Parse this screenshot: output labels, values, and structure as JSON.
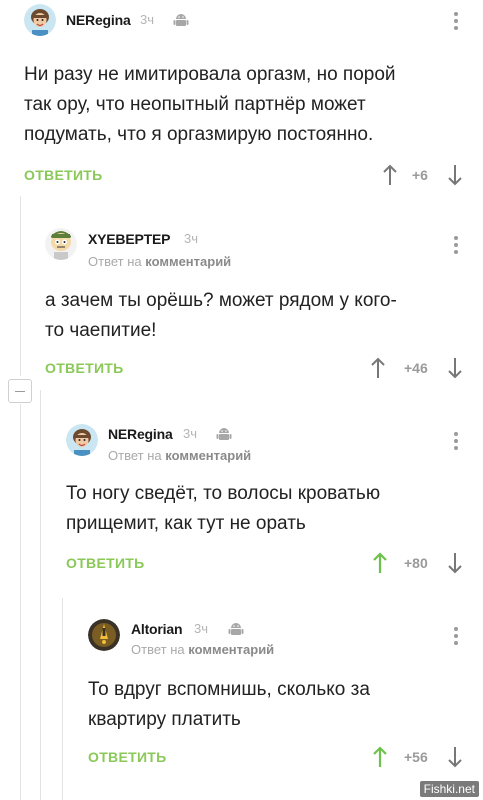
{
  "comments": [
    {
      "nick": "NERegina",
      "time": "3ч",
      "reply_prefix": "",
      "reply_target": "",
      "text_lines": [
        "Ни разу не имитировала оргазм, но порой",
        "так ору, что неопытный партнёр может",
        "подумать, что я оргазмирую постоянно."
      ],
      "reply_label": "ОТВЕТИТЬ",
      "rating": "+6",
      "voted_up": false
    },
    {
      "nick": "XYEBEPTEP",
      "time": "3ч",
      "reply_prefix": "Ответ на",
      "reply_target": "комментарий",
      "text_lines": [
        "а зачем ты орёшь? может рядом у кого-",
        "то чаепитие!"
      ],
      "reply_label": "ОТВЕТИТЬ",
      "rating": "+46",
      "voted_up": false
    },
    {
      "nick": "NERegina",
      "time": "3ч",
      "reply_prefix": "Ответ на",
      "reply_target": "комментарий",
      "text_lines": [
        "То ногу сведёт, то волосы кроватью",
        "прищемит, как тут не орать"
      ],
      "reply_label": "ОТВЕТИТЬ",
      "rating": "+80",
      "voted_up": true
    },
    {
      "nick": "Altorian",
      "time": "3ч",
      "reply_prefix": "Ответ на",
      "reply_target": "комментарий",
      "text_lines": [
        "То вдруг вспомнишь, сколько за",
        "квартиру платить"
      ],
      "reply_label": "ОТВЕТИТЬ",
      "rating": "+56",
      "voted_up": true
    }
  ],
  "watermark": "Fishki.net",
  "colors": {
    "accent_green": "#8ac858",
    "muted": "#9a9a9a"
  }
}
